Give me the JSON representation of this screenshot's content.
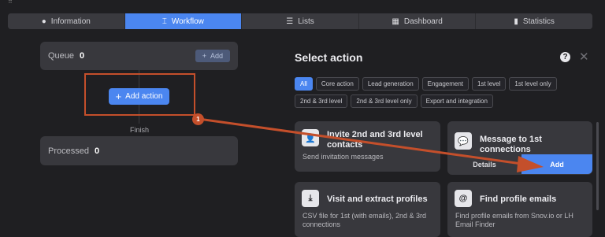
{
  "tabs": [
    {
      "label": "Information",
      "icon": "info-icon",
      "active": false
    },
    {
      "label": "Workflow",
      "icon": "workflow-icon",
      "active": true
    },
    {
      "label": "Lists",
      "icon": "list-icon",
      "active": false
    },
    {
      "label": "Dashboard",
      "icon": "dashboard-icon",
      "active": false
    },
    {
      "label": "Statistics",
      "icon": "bar-chart-icon",
      "active": false
    }
  ],
  "workflow": {
    "queue_label": "Queue",
    "queue_count": "0",
    "queue_add_label": "Add",
    "add_action_label": "Add action",
    "finish_label": "Finish",
    "processed_label": "Processed",
    "processed_count": "0"
  },
  "panel": {
    "title": "Select action",
    "filters_row1": [
      "All",
      "Core action",
      "Lead generation",
      "Engagement",
      "1st level",
      "1st level only"
    ],
    "filters_row2": [
      "2nd & 3rd level",
      "2nd & 3rd level only",
      "Export and integration"
    ],
    "active_filter": "All",
    "actions": [
      {
        "title": "Invite 2nd and 3rd level contacts",
        "description": "Send invitation messages",
        "icon": "person-add-icon"
      },
      {
        "title": "Message to 1st connections",
        "details_label": "Details",
        "add_label": "Add",
        "icon": "chat-icon"
      },
      {
        "title": "Visit and extract profiles",
        "description": "CSV file for 1st (with emails), 2nd & 3rd connections",
        "icon": "person-download-icon"
      },
      {
        "title": "Find profile emails",
        "description": "Find profile emails from Snov.io or LH Email Finder",
        "icon": "at-sign-icon"
      }
    ]
  },
  "annotation": {
    "step": "1",
    "color": "#c44f2b"
  },
  "colors": {
    "accent": "#4b86f0",
    "background": "#1f1f22",
    "card": "#38383d"
  }
}
